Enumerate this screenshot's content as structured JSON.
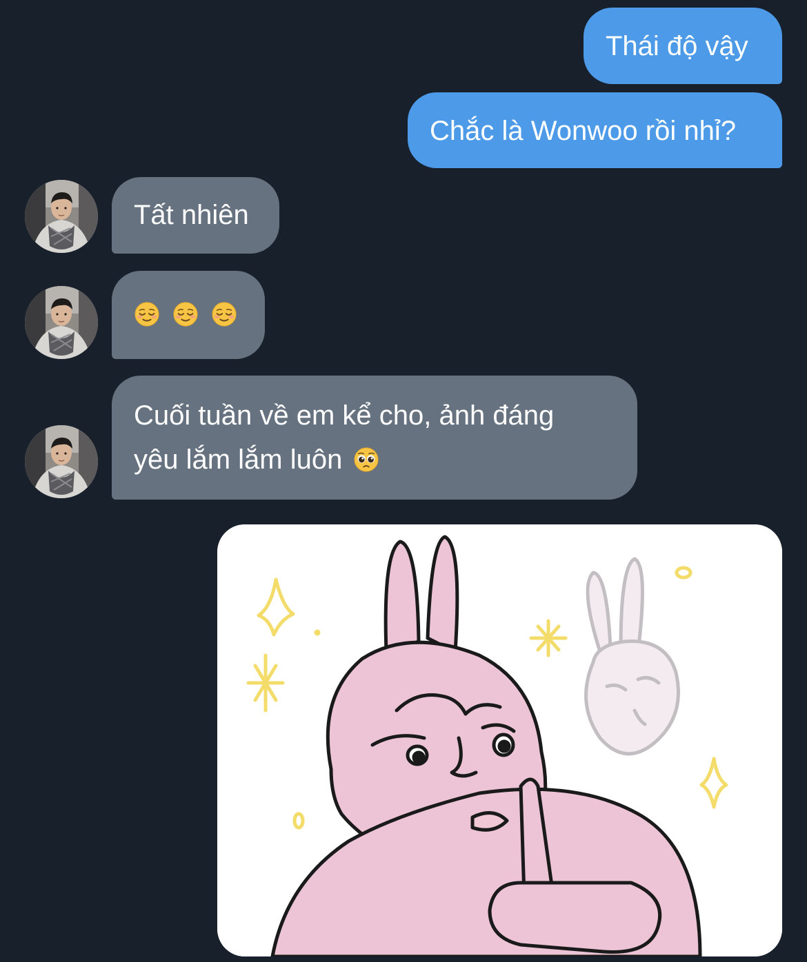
{
  "messages": {
    "sent_1": "Thái độ vậy",
    "sent_2": "Chắc là Wonwoo rồi nhỉ?",
    "recv_1": "Tất nhiên",
    "recv_3_line1": "Cuối tuần về em kể cho, ảnh đáng",
    "recv_3_line2": "yêu lắm lắm luôn"
  },
  "emojis": {
    "recv_2": [
      "relieved-face",
      "relieved-face",
      "relieved-face"
    ],
    "recv_3_end": "pleading-face"
  },
  "sticker": {
    "description_icon": "pink-rabbit-shush-sticker"
  },
  "colors": {
    "background": "#17202b",
    "sent_bubble": "#4d9be8",
    "received_bubble": "#66727f"
  }
}
